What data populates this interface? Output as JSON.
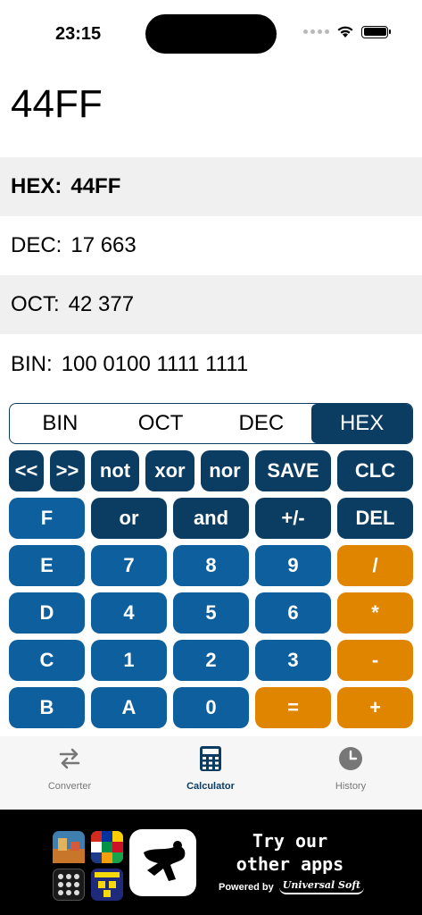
{
  "status": {
    "time": "23:15"
  },
  "display": {
    "value": "44FF"
  },
  "conversions": {
    "hex": {
      "label": "HEX:",
      "value": "44FF"
    },
    "dec": {
      "label": "DEC:",
      "value": "17 663"
    },
    "oct": {
      "label": "OCT:",
      "value": "42 377"
    },
    "bin": {
      "label": "BIN:",
      "value": "100 0100 1111 1111"
    }
  },
  "mode_selector": {
    "options": [
      "BIN",
      "OCT",
      "DEC",
      "HEX"
    ],
    "selected": "HEX"
  },
  "keys": {
    "row1": [
      "<<",
      ">>",
      "not",
      "xor",
      "nor",
      "SAVE",
      "CLC"
    ],
    "row2": [
      "F",
      "or",
      "and",
      "+/-",
      "DEL"
    ],
    "row3": [
      "E",
      "7",
      "8",
      "9",
      "/"
    ],
    "row4": [
      "D",
      "4",
      "5",
      "6",
      "*"
    ],
    "row5": [
      "C",
      "1",
      "2",
      "3",
      "-"
    ],
    "row6": [
      "B",
      "A",
      "0",
      "=",
      "+"
    ]
  },
  "tabs": [
    {
      "label": "Converter",
      "icon": "arrows-swap-icon",
      "active": false
    },
    {
      "label": "Calculator",
      "icon": "calculator-icon",
      "active": true
    },
    {
      "label": "History",
      "icon": "clock-icon",
      "active": false
    }
  ],
  "ad": {
    "headline_line1": "Try our",
    "headline_line2": "other apps",
    "powered_by": "Powered by",
    "brand": "Universal Soft"
  },
  "colors": {
    "dark_blue": "#0b3d63",
    "blue": "#0e5f9d",
    "orange": "#e08500"
  }
}
